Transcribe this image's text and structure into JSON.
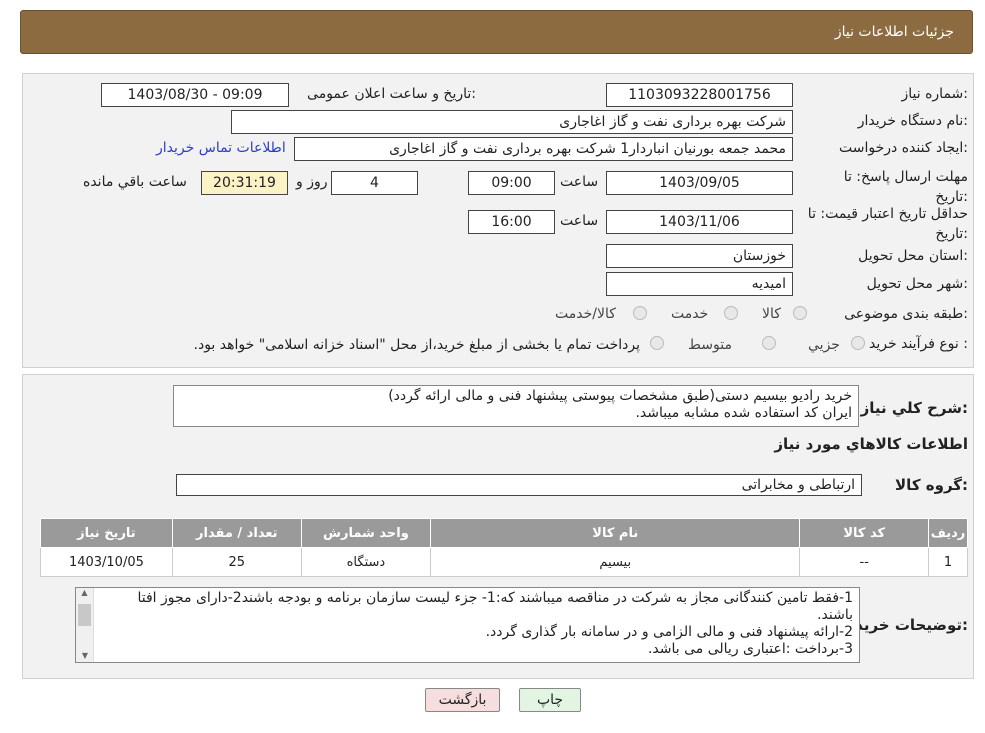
{
  "header": {
    "title": "جزئیات اطلاعات نیاز"
  },
  "form": {
    "need_number_label": "شماره نیاز:",
    "need_number": "1103093228001756",
    "announce_label": "تاریخ و ساعت اعلان عمومی:",
    "announce_value": "1403/08/30 - 09:09",
    "buyer_org_label": "نام دستگاه خریدار:",
    "buyer_org": "شرکت بهره برداری نفت و گاز اغاجاری",
    "requester_label": "ایجاد کننده درخواست:",
    "requester": "محمد جمعه بورنیان انباردار1 شرکت بهره برداری نفت و گاز اغاجاری",
    "contact_link": "اطلاعات تماس خریدار",
    "reply_deadline_label": "مهلت ارسال پاسخ: تا تاریخ:",
    "reply_date": "1403/09/05",
    "time_label": "ساعت",
    "reply_time": "09:00",
    "days": "4",
    "days_label": "روز و",
    "remaining": "20:31:19",
    "remaining_label": "ساعت باقي مانده",
    "validity_label": "حداقل تاریخ اعتبار قیمت: تا تاریخ:",
    "validity_date": "1403/11/06",
    "validity_time": "16:00",
    "province_label": "استان محل تحویل:",
    "province": "خوزستان",
    "city_label": "شهر محل تحویل:",
    "city": "امیدیه",
    "category_label": "طبقه بندی موضوعی:",
    "category_options": [
      "کالا",
      "خدمت",
      "کالا/خدمت"
    ],
    "purchase_type_label": "نوع فرآیند خرید :",
    "purchase_options": [
      "جزیي",
      "متوسط"
    ],
    "purchase_note": "پرداخت تمام یا بخشی از مبلغ خرید،از محل \"اسناد خزانه اسلامی\" خواهد بود."
  },
  "summary": {
    "label": "شرح کلي نیاز:",
    "lines": [
      "خرید رادیو بیسیم دستی(طبق مشخصات پیوستی پیشنهاد فنی و مالی ارائه گردد)",
      "ایران کد استفاده شده مشابه میباشد."
    ]
  },
  "goods": {
    "section_title": "اطلاعات کالاهاي مورد نیاز",
    "group_label": "گروه کالا:",
    "group_value": "ارتباطی و مخابراتی",
    "columns": [
      "ردیف",
      "کد کالا",
      "نام کالا",
      "واحد شمارش",
      "تعداد / مقدار",
      "تاریخ نیاز"
    ],
    "rows": [
      [
        "1",
        "--",
        "بیسیم",
        "دستگاه",
        "25",
        "1403/10/05"
      ]
    ]
  },
  "buyer_notes": {
    "label": "توضیحات خریدار:",
    "lines": [
      "1-فقط تامین کنندگانی مجاز به شرکت در مناقصه میباشند که:1- جزء لیست سازمان برنامه و بودجه باشند2-دارای مجوز افتا باشند.",
      "2-ارائه پیشنهاد فنی و مالی الزامی و در سامانه بار گذاری گردد.",
      "3-برداخت :اعتباری ریالی  می باشد."
    ]
  },
  "buttons": {
    "print": "چاپ",
    "back": "بازگشت"
  },
  "colors": {
    "header_bg": "#8b6b3f",
    "table_header_bg": "#9a9a9a",
    "back_button_bg": "#f6dede",
    "print_button_bg": "#e2f5e2",
    "remaining_bg": "#fbf3c6"
  }
}
